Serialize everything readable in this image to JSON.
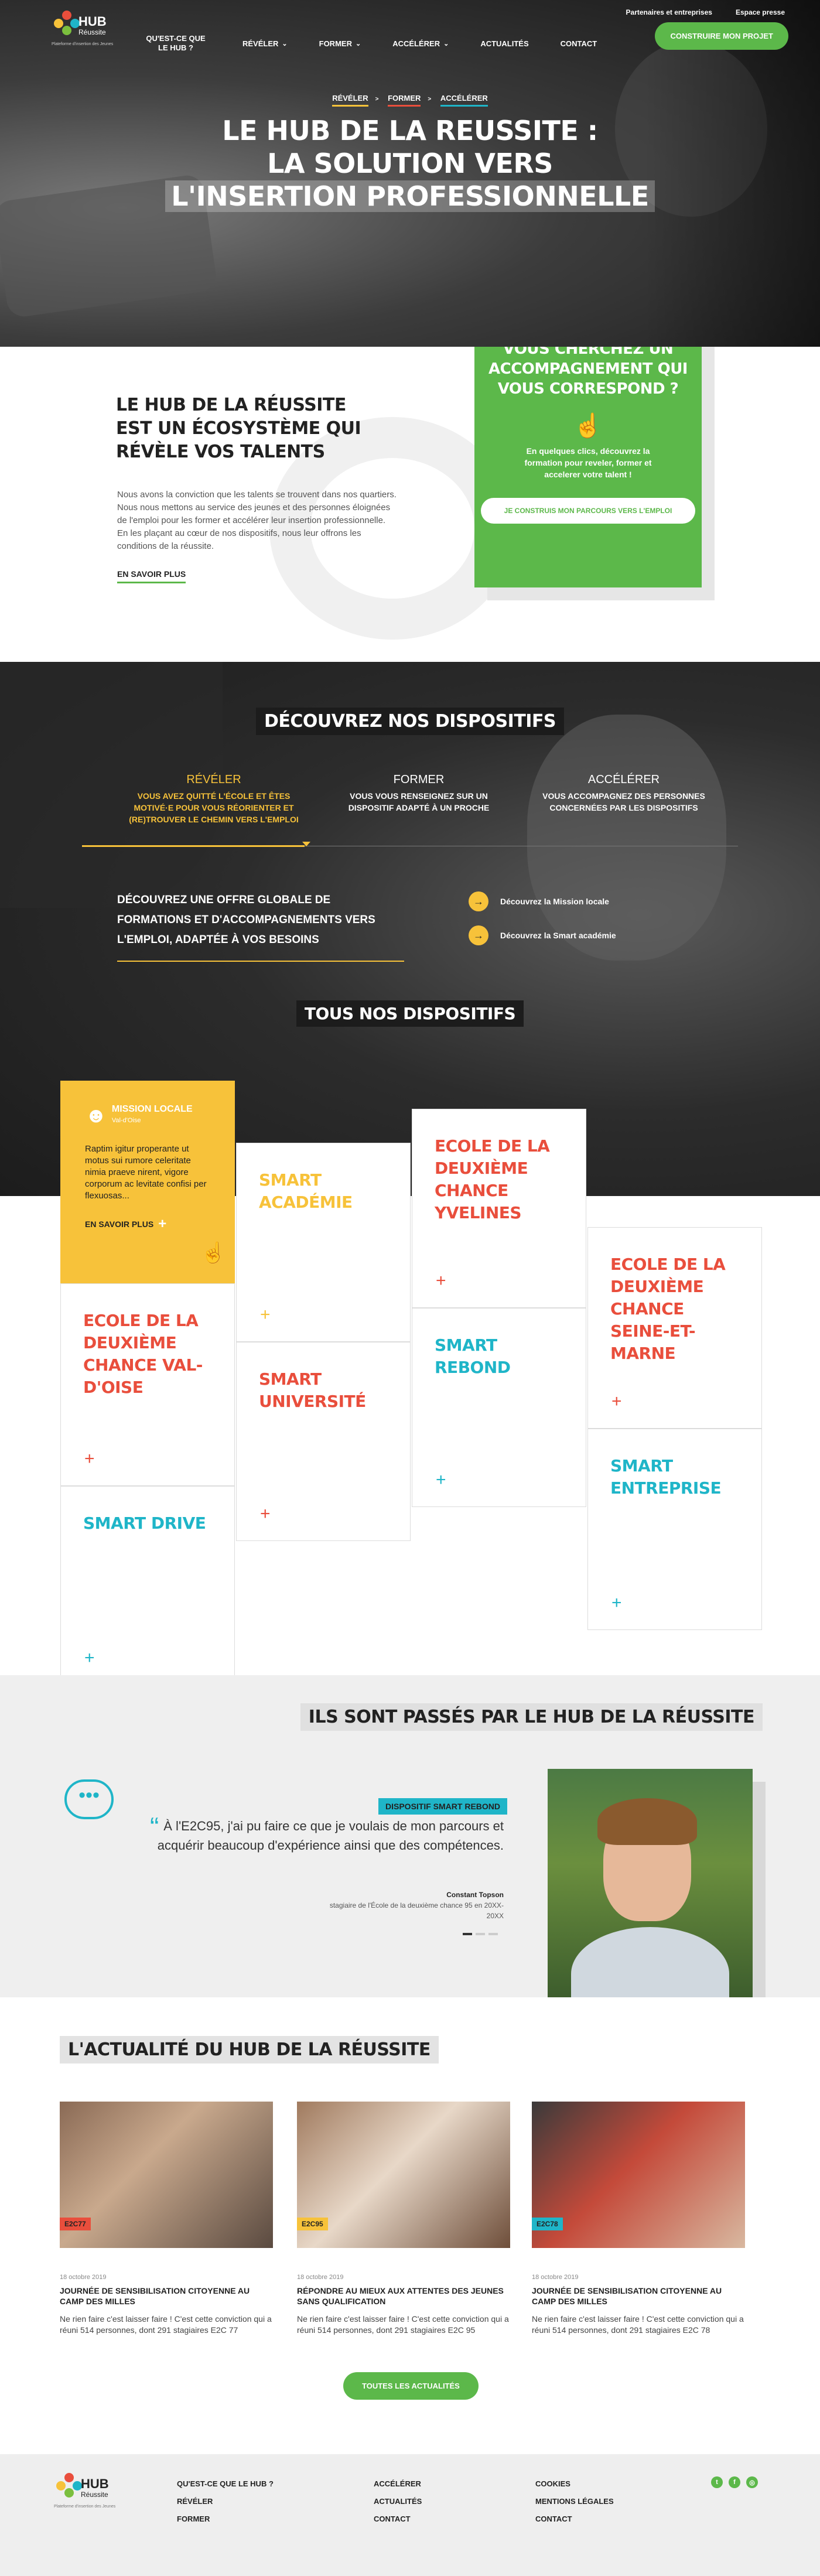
{
  "topbar": {
    "partners": "Partenaires et entreprises",
    "press": "Espace presse"
  },
  "logo": {
    "word": "HUB",
    "sub": "Réussite",
    "tag": "Plateforme d'insertion des Jeunes"
  },
  "nav": {
    "items": [
      "QU'EST-CE QUE LE HUB ?",
      "RÉVÉLER",
      "FORMER",
      "ACCÉLÉRER",
      "ACTUALITÉS",
      "CONTACT"
    ],
    "cta": "CONSTRUIRE MON PROJET"
  },
  "breadcrumb": [
    "RÉVÉLER",
    "FORMER",
    "ACCÉLÉRER"
  ],
  "hero": {
    "line1": "LE HUB DE LA REUSSITE :",
    "line2": "LA SOLUTION VERS",
    "line3": "L'INSERTION PROFESSIONNELLE"
  },
  "intro": {
    "title": "LE HUB DE LA RÉUSSITE EST UN ÉCOSYSTÈME QUI RÉVÈLE VOS TALENTS",
    "text": "Nous avons la conviction que les talents se trouvent dans nos quartiers. Nous nous mettons au service des jeunes et des personnes éloignées de l'emploi pour les former et accélérer leur insertion professionnelle. En les plaçant au cœur de nos dispositifs, nous leur offrons les conditions de la réussite.",
    "more": "EN SAVOIR PLUS"
  },
  "greenbox": {
    "title": "VOUS CHERCHEZ UN ACCOMPAGNEMENT QUI VOUS CORRESPOND ?",
    "text": "En quelques clics, découvrez la formation pour reveler, former et accelerer votre talent !",
    "button": "JE CONSTRUIS MON PARCOURS VERS L'EMPLOI"
  },
  "dispositifs": {
    "title": "DÉCOUVREZ NOS DISPOSITIFS",
    "tabs": [
      {
        "name": "RÉVÉLER",
        "desc": "VOUS AVEZ QUITTÉ L'ÉCOLE ET ÊTES MOTIVÉ·E POUR VOUS RÉORIENTER ET (RE)TROUVER LE CHEMIN VERS L'EMPLOI"
      },
      {
        "name": "FORMER",
        "desc": "VOUS VOUS RENSEIGNEZ SUR UN DISPOSITIF ADAPTÉ À UN PROCHE"
      },
      {
        "name": "ACCÉLÉRER",
        "desc": "VOUS ACCOMPAGNEZ DES PERSONNES CONCERNÉES PAR LES DISPOSITIFS"
      }
    ],
    "offer": "DÉCOUVREZ UNE OFFRE GLOBALE DE FORMATIONS ET D'ACCOMPAGNEMENTS VERS L'EMPLOI, ADAPTÉE À VOS BESOINS",
    "links": [
      "Découvrez la Mission locale",
      "Découvrez la  Smart académie"
    ],
    "all_title": "TOUS NOS DISPOSITIFS"
  },
  "cards": {
    "mission_locale": {
      "logo": "MISSION LOCALE",
      "logo_sub": "Val-d'Oise",
      "text": "Raptim igitur properante ut motus sui rumore celeritate nimia praeve nirent, vigore corporum ac levitate confisi per flexuosas...",
      "more": "EN SAVOIR PLUS"
    },
    "items": [
      "SMART ACADÉMIE",
      "ECOLE DE LA DEUXIÈME CHANCE YVELINES",
      "ECOLE DE LA DEUXIÈME CHANCE SEINE-ET-MARNE",
      "ECOLE DE LA DEUXIÈME CHANCE VAL-D'OISE",
      "SMART REBOND",
      "SMART UNIVERSITÉ",
      "SMART ENTREPRISE",
      "SMART DRIVE"
    ]
  },
  "testimonial": {
    "title": "ILS SONT PASSÉS PAR LE HUB DE LA RÉUSSITE",
    "label": "DISPOSITIF SMART REBOND",
    "quote": "À l'E2C95, j'ai pu faire ce que je voulais de mon parcours et acquérir beaucoup d'expérience ainsi que des compétences.",
    "author": "Constant Topson",
    "role": "stagiaire de l'École de la deuxième chance 95 en 20XX-20XX"
  },
  "news": {
    "title": "L'ACTUALITÉ DU HUB DE LA RÉUSSITE",
    "articles": [
      {
        "badge": "E2C77",
        "date": "18 octobre 2019",
        "title": "JOURNÉE DE SENSIBILISATION CITOYENNE AU CAMP DES MILLES",
        "text": "Ne rien faire c'est laisser faire ! C'est cette conviction qui a réuni 514 personnes, dont 291 stagiaires E2C 77"
      },
      {
        "badge": "E2C95",
        "date": "18 octobre 2019",
        "title": "RÉPONDRE AU MIEUX AUX ATTENTES DES JEUNES SANS QUALIFICATION",
        "text": "Ne rien faire c'est laisser faire ! C'est cette conviction qui a réuni 514 personnes, dont 291 stagiaires E2C 95"
      },
      {
        "badge": "E2C78",
        "date": "18 octobre 2019",
        "title": "JOURNÉE DE SENSIBILISATION CITOYENNE AU CAMP DES MILLES",
        "text": "Ne rien faire c'est laisser faire ! C'est cette conviction qui a réuni 514 personnes, dont 291 stagiaires E2C 78"
      }
    ],
    "all": "TOUTES LES ACTUALITÉS"
  },
  "footer": {
    "col1": [
      "QU'EST-CE QUE LE HUB ?",
      "RÉVÉLER",
      "FORMER"
    ],
    "col2": [
      "ACCÉLÉRER",
      "ACTUALITÉS",
      "CONTACT"
    ],
    "col3": [
      "COOKIES",
      "MENTIONS LÉGALES",
      "CONTACT"
    ],
    "social": [
      "twitter-icon",
      "facebook-icon",
      "instagram-icon"
    ]
  },
  "colors": {
    "green": "#5cb84a",
    "yellow": "#f7c23a",
    "red": "#e94e3c",
    "teal": "#1fb5c8"
  }
}
